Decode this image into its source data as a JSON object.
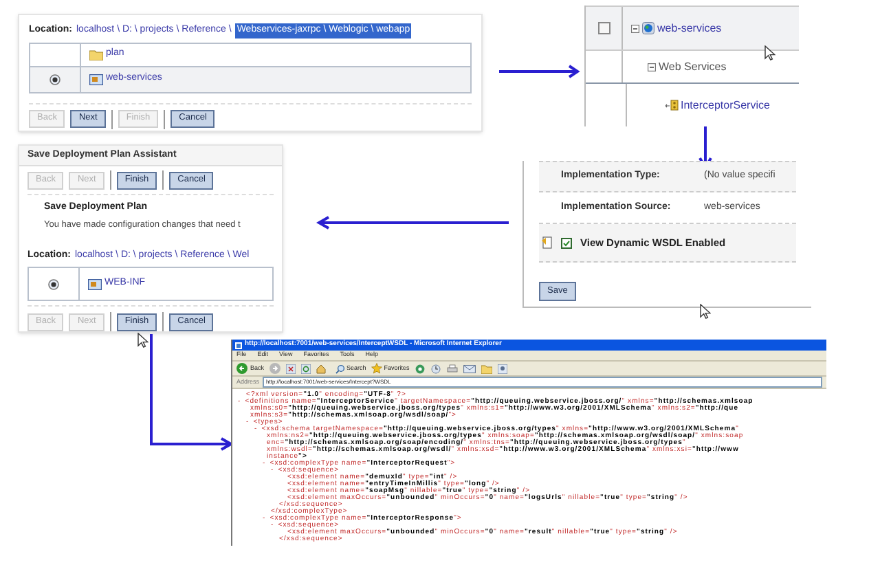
{
  "location_panel": {
    "location_label": "Location:",
    "path_parts": [
      {
        "text": "localhost \\ D: \\ projects \\ Reference \\",
        "selected": false
      },
      {
        "text": "Webservices-jaxrpc \\ Weblogic \\ webapp",
        "selected": true
      }
    ],
    "rows": [
      {
        "name": "plan",
        "kind": "folder",
        "selected": false
      },
      {
        "name": "web-services",
        "kind": "application",
        "selected": true
      }
    ],
    "buttons": [
      {
        "label": "Back",
        "disabled": true
      },
      {
        "label": "Next",
        "disabled": false
      },
      {
        "label": "Finish",
        "disabled": true
      },
      {
        "label": "Cancel",
        "disabled": false
      }
    ]
  },
  "tree_panel": {
    "items": [
      {
        "label": "web-services",
        "checked": false,
        "expanded": true,
        "children": [
          {
            "label": "Web Services",
            "expanded": true,
            "children": [
              {
                "label": "InterceptorService"
              }
            ]
          }
        ]
      }
    ]
  },
  "config_panel": {
    "fields": [
      {
        "label": "Implementation Type:",
        "value": "(No value specifi"
      },
      {
        "label": "Implementation Source:",
        "value": "web-services"
      }
    ],
    "checkbox": {
      "label": "View Dynamic WSDL Enabled",
      "checked": true
    },
    "save_button": "Save"
  },
  "plan_panel": {
    "title": "Save Deployment Plan Assistant",
    "top_buttons": [
      {
        "label": "Back",
        "disabled": true
      },
      {
        "label": "Next",
        "disabled": true
      },
      {
        "label": "Finish",
        "disabled": false
      },
      {
        "label": "Cancel",
        "disabled": false
      }
    ],
    "heading": "Save Deployment Plan",
    "message": "You have made configuration changes that need t",
    "location_label": "Location:",
    "path_parts": [
      {
        "text": "localhost \\ D: \\ projects \\ Reference \\ Wel",
        "selected": false
      }
    ],
    "rows": [
      {
        "name": "WEB-INF",
        "kind": "application",
        "selected": true
      }
    ],
    "bottom_buttons": [
      {
        "label": "Back",
        "disabled": true
      },
      {
        "label": "Next",
        "disabled": true
      },
      {
        "label": "Finish",
        "disabled": false
      },
      {
        "label": "Cancel",
        "disabled": false
      }
    ]
  },
  "browser": {
    "title": "http://localhost:7001/web-services/InterceptWSDL - Microsoft Internet Explorer",
    "menu": [
      "File",
      "Edit",
      "View",
      "Favorites",
      "Tools",
      "Help"
    ],
    "toolbar": {
      "back": "Back",
      "search": "Search",
      "favorites": "Favorites"
    },
    "address_label": "Address",
    "url": "http://localhost:7001/web-services/Intercept?WSDL",
    "xml": [
      {
        "lines": [
          "<?xml version=\"1.0\" encoding=\"UTF-8\" ?>"
        ]
      },
      {
        "toggle": "-",
        "lines": [
          "<definitions name=\"InterceptorService\" targetNamespace=\"http://queuing.webservice.jboss.org/\" xmlns=\"http://schemas.xmlsoap",
          "xmlns:s0=\"http://queuing.webservice.jboss.org/types\" xmlns:s1=\"http://www.w3.org/2001/XMLSchema\" xmlns:s2=\"http://que",
          "xmlns:s3=\"http://schemas.xmlsoap.org/wsdl/soap/\">"
        ],
        "children": [
          {
            "toggle": "-",
            "lines": [
              "<types>"
            ],
            "children": [
              {
                "toggle": "-",
                "lines": [
                  "<xsd:schema targetNamespace=\"http://queuing.webservice.jboss.org/types\" xmlns=\"http://www.w3.org/2001/XMLSchema\"",
                  "xmlns:ns2=\"http://queuing.webservice.jboss.org/types\" xmlns:soap=\"http://schemas.xmlsoap.org/wsdl/soap/\" xmlns:soap",
                  "enc=\"http://schemas.xmlsoap.org/soap/encoding/\" xmlns:tns=\"http://queuing.webservice.jboss.org/types\"",
                  "xmlns:wsdl=\"http://schemas.xmlsoap.org/wsdl/\" xmlns:xsd=\"http://www.w3.org/2001/XMLSchema\" xmlns:xsi=\"http://www",
                  "instance\">"
                ],
                "children": [
                  {
                    "toggle": "-",
                    "lines": [
                      "<xsd:complexType name=\"InterceptorRequest\">"
                    ],
                    "close": "</xsd:complexType>",
                    "children": [
                      {
                        "toggle": "-",
                        "lines": [
                          "<xsd:sequence>"
                        ],
                        "close": "</xsd:sequence>",
                        "children": [
                          {
                            "lines": [
                              "<xsd:element name=\"demuxId\" type=\"int\" />"
                            ]
                          },
                          {
                            "lines": [
                              "<xsd:element name=\"entryTimeInMillis\" type=\"long\" />"
                            ]
                          },
                          {
                            "lines": [
                              "<xsd:element name=\"soapMsg\" nillable=\"true\" type=\"string\" />"
                            ]
                          },
                          {
                            "lines": [
                              "<xsd:element maxOccurs=\"unbounded\" minOccurs=\"0\" name=\"logsUrls\" nillable=\"true\" type=\"string\" />"
                            ]
                          }
                        ]
                      }
                    ]
                  },
                  {
                    "toggle": "-",
                    "lines": [
                      "<xsd:complexType name=\"InterceptorResponse\">"
                    ],
                    "children": [
                      {
                        "toggle": "-",
                        "lines": [
                          "<xsd:sequence>"
                        ],
                        "close": "</xsd:sequence>",
                        "children": [
                          {
                            "lines": [
                              "<xsd:element maxOccurs=\"unbounded\" minOccurs=\"0\" name=\"result\" nillable=\"true\" type=\"string\" />"
                            ]
                          }
                        ]
                      }
                    ]
                  }
                ]
              }
            ]
          }
        ]
      }
    ]
  }
}
